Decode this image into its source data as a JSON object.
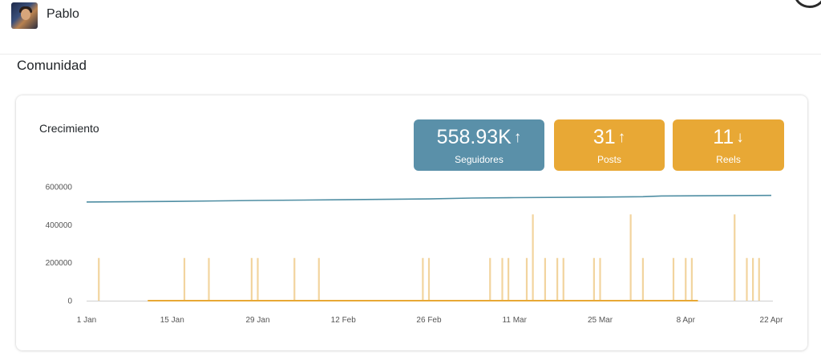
{
  "header": {
    "username": "Pablo",
    "avatar_icon": "user-avatar-photo"
  },
  "section": {
    "title": "Comunidad"
  },
  "card": {
    "title": "Crecimiento",
    "stats": [
      {
        "value": "558.93K",
        "trend": "↑",
        "label": "Seguidores",
        "color": "#5a90a9"
      },
      {
        "value": "31",
        "trend": "↑",
        "label": "Posts",
        "color": "#e8a835"
      },
      {
        "value": "11",
        "trend": "↓",
        "label": "Reels",
        "color": "#e8a835"
      }
    ]
  },
  "chart_data": {
    "type": "line",
    "x_ticks": [
      "1 Jan",
      "15 Jan",
      "29 Jan",
      "12 Feb",
      "26 Feb",
      "11 Mar",
      "25 Mar",
      "8 Apr",
      "22 Apr"
    ],
    "y_ticks": [
      "600000",
      "400000",
      "200000",
      "0"
    ],
    "ylim": [
      0,
      600000
    ],
    "xlim": [
      "2024-01-01",
      "2024-04-22"
    ],
    "grid": false,
    "legend": "none",
    "series": [
      {
        "color": "#4f8ea3",
        "kind": "line",
        "points": [
          [
            "2024-01-01",
            520000
          ],
          [
            "2024-01-15",
            523000
          ],
          [
            "2024-01-29",
            528000
          ],
          [
            "2024-02-12",
            532000
          ],
          [
            "2024-02-26",
            536000
          ],
          [
            "2024-03-04",
            541000
          ],
          [
            "2024-03-11",
            543000
          ],
          [
            "2024-03-25",
            546000
          ],
          [
            "2024-04-01",
            548000
          ],
          [
            "2024-04-04",
            552000
          ],
          [
            "2024-04-22",
            555000
          ]
        ]
      },
      {
        "color": "#f2d49e",
        "kind": "spikes",
        "points": [
          [
            "2024-01-03",
            225000
          ],
          [
            "2024-01-17",
            225000
          ],
          [
            "2024-01-21",
            225000
          ],
          [
            "2024-01-28",
            225000
          ],
          [
            "2024-01-29",
            225000
          ],
          [
            "2024-02-04",
            225000
          ],
          [
            "2024-02-08",
            225000
          ],
          [
            "2024-02-25",
            225000
          ],
          [
            "2024-02-26",
            225000
          ],
          [
            "2024-03-07",
            225000
          ],
          [
            "2024-03-09",
            225000
          ],
          [
            "2024-03-10",
            225000
          ],
          [
            "2024-03-13",
            225000
          ],
          [
            "2024-03-14",
            455000
          ],
          [
            "2024-03-16",
            225000
          ],
          [
            "2024-03-18",
            225000
          ],
          [
            "2024-03-19",
            225000
          ],
          [
            "2024-03-24",
            225000
          ],
          [
            "2024-03-25",
            225000
          ],
          [
            "2024-03-30",
            455000
          ],
          [
            "2024-04-01",
            225000
          ],
          [
            "2024-04-06",
            225000
          ],
          [
            "2024-04-08",
            225000
          ],
          [
            "2024-04-09",
            225000
          ],
          [
            "2024-04-16",
            455000
          ],
          [
            "2024-04-18",
            225000
          ],
          [
            "2024-04-19",
            225000
          ],
          [
            "2024-04-20",
            225000
          ]
        ]
      },
      {
        "color": "#e8a835",
        "kind": "line",
        "points": [
          [
            "2024-01-11",
            0
          ],
          [
            "2024-04-10",
            0
          ]
        ]
      }
    ]
  }
}
